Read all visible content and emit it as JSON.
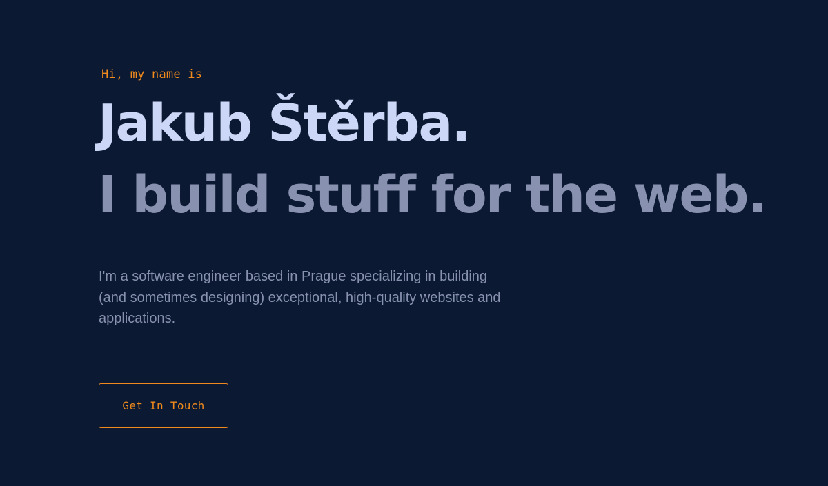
{
  "hero": {
    "greeting": "Hi, my name is",
    "name": "Jakub Štěrba.",
    "tagline": "I build stuff for the web.",
    "intro": "I'm a software engineer based in Prague specializing in building (and sometimes designing) exceptional, high-quality websites and applications.",
    "cta_label": "Get In Touch"
  },
  "colors": {
    "background": "#0b1932",
    "accent": "#f08a1c",
    "heading": "#ccd6f6",
    "muted": "#8892b0"
  }
}
